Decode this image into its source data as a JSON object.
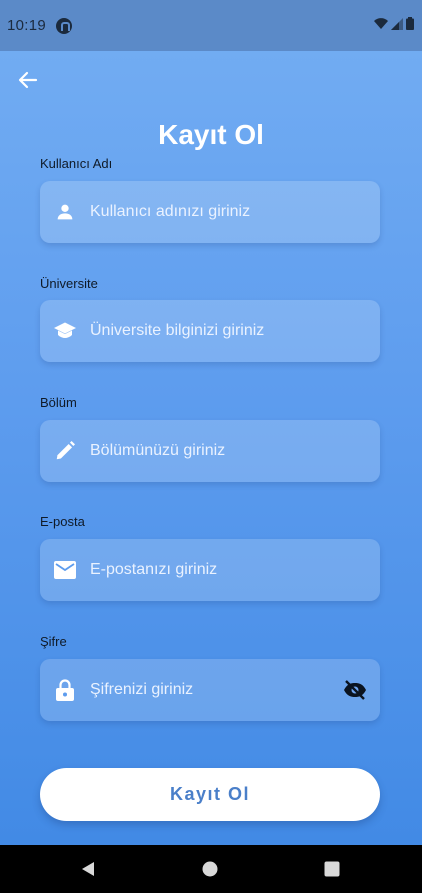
{
  "status_bar": {
    "time": "10:19",
    "icons": [
      "app-notification-icon",
      "wifi-icon",
      "signal-icon",
      "battery-icon"
    ]
  },
  "header": {
    "back_icon": "arrow-left-icon",
    "title": "Kayıt Ol"
  },
  "form": {
    "fields": [
      {
        "label": "Kullanıcı Adı",
        "placeholder": "Kullanıcı adınızı giriniz",
        "icon": "person-icon"
      },
      {
        "label": "Üniversite",
        "placeholder": "Üniversite bilginizi giriniz",
        "icon": "graduation-cap-icon"
      },
      {
        "label": "Bölüm",
        "placeholder": "Bölümünüzü giriniz",
        "icon": "pencil-icon"
      },
      {
        "label": "E-posta",
        "placeholder": "E-postanızı giriniz",
        "icon": "mail-icon"
      },
      {
        "label": "Şifre",
        "placeholder": "Şifrenizi giriniz",
        "icon": "lock-icon",
        "trailing_icon": "eye-off-icon"
      }
    ],
    "submit_label": "Kayıt Ol"
  },
  "nav": {
    "buttons": [
      "back-triangle-icon",
      "home-circle-icon",
      "recents-square-icon"
    ]
  },
  "colors": {
    "gradient_top": "#74aef3",
    "gradient_bottom": "#3f88e4",
    "status_bar": "#5b8ac8",
    "button_text": "#4a7fc9"
  }
}
